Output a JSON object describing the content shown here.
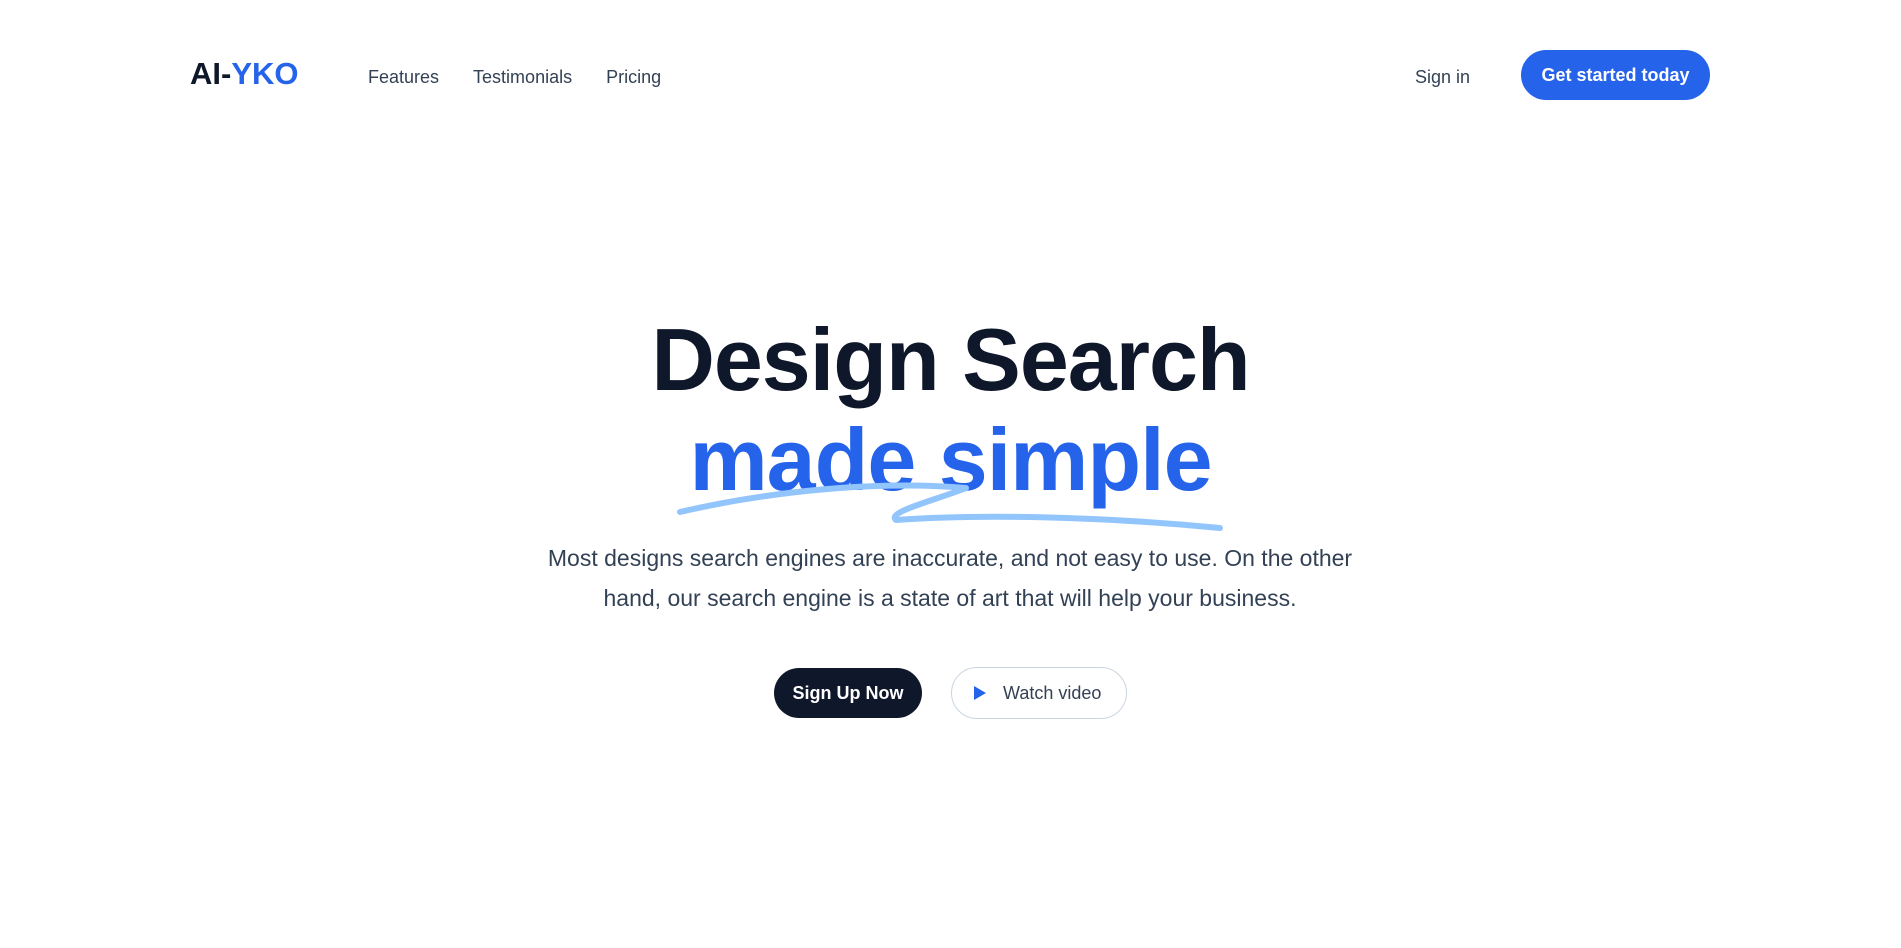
{
  "brand": {
    "logo_part1": "AI-",
    "logo_part2": "YKO"
  },
  "nav": {
    "items": [
      {
        "label": "Features"
      },
      {
        "label": "Testimonials"
      },
      {
        "label": "Pricing"
      }
    ],
    "signin_label": "Sign in",
    "cta_label": "Get started today"
  },
  "hero": {
    "title_line1": "Design Search",
    "title_line2": "made simple",
    "description": "Most designs search engines are inaccurate, and not easy to use. On the other hand, our search engine is a state of art that will help your business.",
    "primary_button": "Sign Up Now",
    "secondary_button": "Watch video",
    "secondary_icon": "play-icon"
  },
  "colors": {
    "accent": "#2563eb",
    "dark": "#0f172a",
    "text": "#334155",
    "underline": "#93c5fd"
  }
}
